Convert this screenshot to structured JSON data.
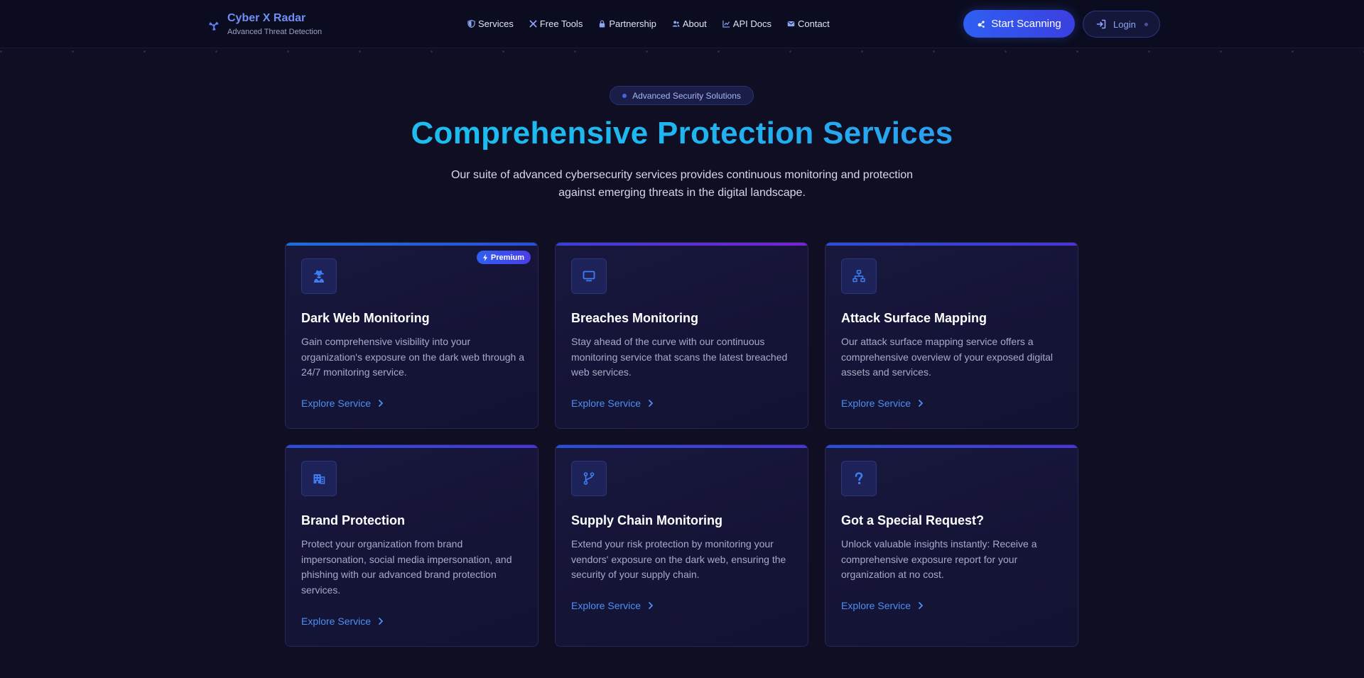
{
  "header": {
    "brand_title": "Cyber X Radar",
    "brand_subtitle": "Advanced Threat Detection",
    "nav": [
      {
        "label": "Services",
        "icon": "shield-icon"
      },
      {
        "label": "Free Tools",
        "icon": "tools-icon"
      },
      {
        "label": "Partnership",
        "icon": "lock-icon"
      },
      {
        "label": "About",
        "icon": "users-icon"
      },
      {
        "label": "API Docs",
        "icon": "chart-line-icon"
      },
      {
        "label": "Contact",
        "icon": "envelope-icon"
      }
    ],
    "start_button": "Start Scanning",
    "login_button": "Login"
  },
  "hero": {
    "pill": "Advanced Security Solutions",
    "title": "Comprehensive Protection Services",
    "description": "Our suite of advanced cybersecurity services provides continuous monitoring and protection against emerging threats in the digital landscape."
  },
  "cards": [
    {
      "title": "Dark Web Monitoring",
      "description": "Gain comprehensive visibility into your organization's exposure on the dark web through a 24/7 monitoring service.",
      "link": "Explore Service",
      "badge": "Premium",
      "icon": "user-secret-icon",
      "accent": [
        "#1e6fd9",
        "#2a4fd8"
      ]
    },
    {
      "title": "Breaches Monitoring",
      "description": "Stay ahead of the curve with our continuous monitoring service that scans the latest breached web services.",
      "link": "Explore Service",
      "icon": "monitor-icon",
      "accent": [
        "#3b3fd8",
        "#7a22d6"
      ]
    },
    {
      "title": "Attack Surface Mapping",
      "description": "Our attack surface mapping service offers a comprehensive overview of your exposed digital assets and services.",
      "link": "Explore Service",
      "icon": "network-icon",
      "accent": [
        "#2a4fd8",
        "#4a34d8"
      ]
    },
    {
      "title": "Brand Protection",
      "description": "Protect your organization from brand impersonation, social media impersonation, and phishing with our advanced brand protection services.",
      "link": "Explore Service",
      "icon": "building-icon",
      "accent": [
        "#2a4fd8",
        "#4a34d8"
      ]
    },
    {
      "title": "Supply Chain Monitoring",
      "description": "Extend your risk protection by monitoring your vendors' exposure on the dark web, ensuring the security of your supply chain.",
      "link": "Explore Service",
      "icon": "code-branch-icon",
      "accent": [
        "#2a4fd8",
        "#4a34d8"
      ]
    },
    {
      "title": "Got a Special Request?",
      "description": "Unlock valuable insights instantly: Receive a comprehensive exposure report for your organization at no cost.",
      "link": "Explore Service",
      "icon": "question-icon",
      "accent": [
        "#2a4fd8",
        "#4a34d8"
      ]
    }
  ]
}
